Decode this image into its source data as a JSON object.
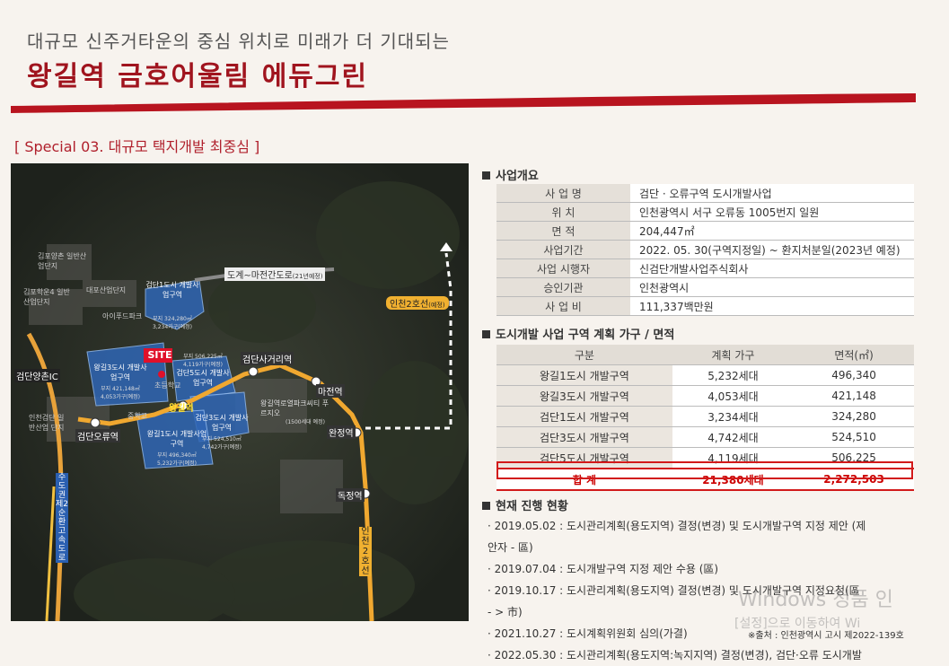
{
  "header": {
    "subtitle": "대규모 신주거타운의 중심 위치로 미래가 더 기대되는",
    "title": "왕길역 금호어울림 에듀그린"
  },
  "special": "[ Special 03. 대규모 택지개발 최중심 ]",
  "map": {
    "site_label": "SITE",
    "stations": [
      "검단오류역",
      "왕길역",
      "검단사거리역",
      "마전역",
      "완정역",
      "독정역"
    ],
    "interchange": "검단양촌IC",
    "road": "도계~마전간도로",
    "road_note": "(21년예정)",
    "line2": "인천2호선",
    "line2_note": "(예정)",
    "line2_vertical": "인천2호선",
    "highway": "수도권제2순환고속도로",
    "places": [
      "김포양촌 일반산업단지",
      "대포산업단지",
      "김포학운4 일반산업단지",
      "아이푸드파크",
      "인천검단 일반산업 단지",
      "초등학교",
      "중학교",
      "왕길역로열파크씨티 푸르지오",
      "(1500세대 예정)"
    ],
    "zones": [
      {
        "name": "검단1도시 개발사업구역",
        "area": "부지 324,280㎡",
        "units": "3,234가구(예정)"
      },
      {
        "name": "왕길3도시 개발사업구역",
        "area": "부지 421,148㎡",
        "units": "4,053가구(예정)"
      },
      {
        "name": "검단5도시 개발사업구역",
        "area": "부지 506,225㎡",
        "units": "4,119가구(예정)"
      },
      {
        "name": "검단3도시 개발사업구역",
        "area": "부지 524,510㎡",
        "units": "4,742가구(예정)"
      },
      {
        "name": "왕길1도시 개발사업구역",
        "area": "부지 496,340㎡",
        "units": "5,232가구(예정)"
      }
    ]
  },
  "overview": {
    "heading": "사업개요",
    "rows": [
      {
        "k": "사 업 명",
        "v": "검단 · 오류구역 도시개발사업"
      },
      {
        "k": "위 치",
        "v": "인천광역시 서구 오류동 1005번지 일원"
      },
      {
        "k": "면 적",
        "v": "204,447㎡"
      },
      {
        "k": "사업기간",
        "v": "2022. 05. 30(구역지정일) ~ 환지처분일(2023년 예정)"
      },
      {
        "k": "사업 시행자",
        "v": "신검단개발사업주식회사"
      },
      {
        "k": "승인기관",
        "v": "인천광역시"
      },
      {
        "k": "사 업 비",
        "v": "111,337백만원"
      }
    ]
  },
  "plan": {
    "heading": "도시개발 사업 구역 계획 가구 / 면적",
    "cols": [
      "구분",
      "계획 가구",
      "면적(㎡)"
    ],
    "rows": [
      {
        "a": "왕길1도시 개발구역",
        "b": "5,232세대",
        "c": "496,340"
      },
      {
        "a": "왕길3도시 개발구역",
        "b": "4,053세대",
        "c": "421,148"
      },
      {
        "a": "검단1도시 개발구역",
        "b": "3,234세대",
        "c": "324,280"
      },
      {
        "a": "검단3도시 개발구역",
        "b": "4,742세대",
        "c": "524,510"
      },
      {
        "a": "검단5도시 개발구역",
        "b": "4,119세대",
        "c": "506,225"
      }
    ],
    "total": {
      "a": "합 계",
      "b": "21,380세대",
      "c": "2,272,503"
    }
  },
  "progress": {
    "heading": "현재 진행 현황",
    "items": [
      "· 2019.05.02 : 도시관리계획(용도지역) 결정(변경) 및 도시개발구역 지정 제안 (제",
      "  안자 - 區)",
      "· 2019.07.04 : 도시개발구역 지정 제안 수용 (區)",
      "· 2019.10.17 : 도시관리계획(용도지역) 결정(변경) 및 도시개발구역 지정요청(區",
      "  - > 市)",
      "· 2021.10.27 : 도시계획위원회 심의(가결)",
      "· 2022.05.30 : 도시관리계획(용도지역:녹지지역) 결정(변경), 검단·오류 도시개발"
    ]
  },
  "source": "※출처 : 인천광역시 고시 제2022-139호",
  "watermark": {
    "line1": "Windows 정품 인",
    "line2": "[설정]으로 이동하여 Wi"
  }
}
